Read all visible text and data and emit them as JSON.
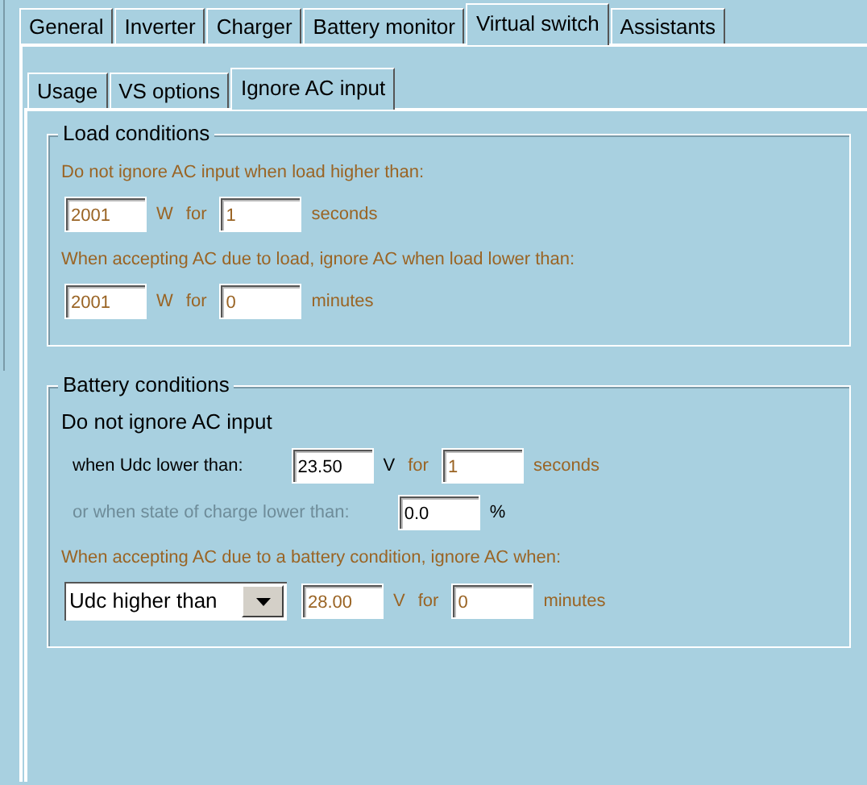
{
  "tabs": [
    {
      "label": "General",
      "selected": false
    },
    {
      "label": "Inverter",
      "selected": false
    },
    {
      "label": "Charger",
      "selected": false
    },
    {
      "label": "Battery monitor",
      "selected": false
    },
    {
      "label": "Virtual switch",
      "selected": true
    },
    {
      "label": "Assistants",
      "selected": false
    }
  ],
  "subtabs": [
    {
      "label": "Usage",
      "selected": false
    },
    {
      "label": "VS options",
      "selected": false
    },
    {
      "label": "Ignore AC input",
      "selected": true
    }
  ],
  "groups": [
    {
      "title": "Load conditions",
      "lines": [
        {
          "kind": "note",
          "text": "Do not ignore AC input when load higher than:"
        },
        {
          "kind": "controls",
          "items": [
            {
              "kind": "field",
              "value": "2001",
              "color": "#9a6424"
            },
            {
              "kind": "text",
              "text": "W",
              "color": "#9a6424"
            },
            {
              "kind": "text",
              "text": "for",
              "color": "#9a6424"
            },
            {
              "kind": "field",
              "value": "1",
              "color": "#9a6424"
            },
            {
              "kind": "text",
              "text": "seconds",
              "color": "#9a6424"
            }
          ]
        },
        {
          "kind": "note",
          "text": "When accepting AC due to load, ignore AC when load lower than:"
        },
        {
          "kind": "controls",
          "items": [
            {
              "kind": "field",
              "value": "2001",
              "color": "#9a6424"
            },
            {
              "kind": "text",
              "text": "W",
              "color": "#9a6424"
            },
            {
              "kind": "text",
              "text": "for",
              "color": "#9a6424"
            },
            {
              "kind": "field",
              "value": "0",
              "color": "#9a6424"
            },
            {
              "kind": "text",
              "text": "minutes",
              "color": "#9a6424"
            }
          ]
        }
      ]
    },
    {
      "title": "Battery conditions",
      "lines": [
        {
          "kind": "heading",
          "text": "Do not ignore AC input"
        },
        {
          "kind": "controls",
          "items": [
            {
              "kind": "label",
              "text": "when Udc lower than:",
              "disabled": false
            },
            {
              "kind": "field",
              "value": "23.50",
              "color": "#000000"
            },
            {
              "kind": "text",
              "text": "V",
              "color": "#000000"
            },
            {
              "kind": "text",
              "text": "for",
              "color": "#9a6424"
            },
            {
              "kind": "field",
              "value": "1",
              "color": "#9a6424"
            },
            {
              "kind": "text",
              "text": "seconds",
              "color": "#9a6424"
            }
          ]
        },
        {
          "kind": "controls",
          "items": [
            {
              "kind": "label",
              "text": "or when state of charge lower than:",
              "disabled": true
            },
            {
              "kind": "field",
              "value": "0.0",
              "color": "#000000"
            },
            {
              "kind": "text",
              "text": "%",
              "color": "#000000"
            }
          ]
        },
        {
          "kind": "note",
          "text": "When accepting AC due to a battery condition, ignore AC when:"
        },
        {
          "kind": "controls",
          "items": [
            {
              "kind": "select",
              "value": "Udc higher than"
            },
            {
              "kind": "field",
              "value": "28.00",
              "color": "#9a6424"
            },
            {
              "kind": "text",
              "text": "V",
              "color": "#9a6424"
            },
            {
              "kind": "text",
              "text": "for",
              "color": "#9a6424"
            },
            {
              "kind": "field",
              "value": "0",
              "color": "#9a6424"
            },
            {
              "kind": "text",
              "text": "minutes",
              "color": "#9a6424"
            }
          ]
        }
      ]
    }
  ]
}
